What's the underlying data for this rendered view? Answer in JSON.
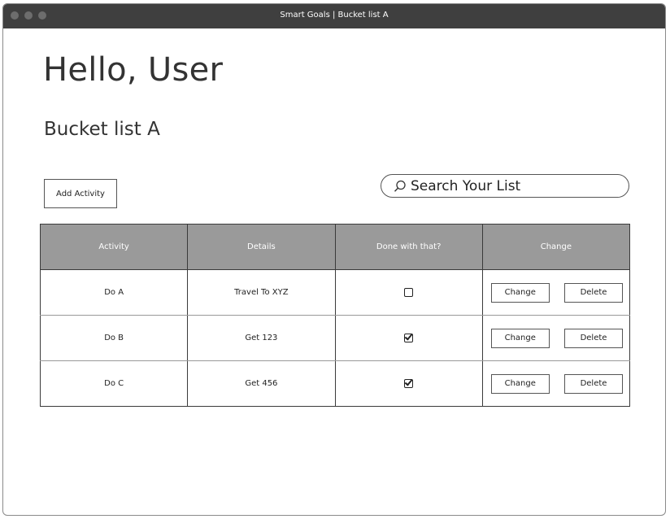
{
  "window": {
    "title": "Smart Goals | Bucket list A"
  },
  "header": {
    "greeting": "Hello, User",
    "list_title": "Bucket list A"
  },
  "toolbar": {
    "add_label": "Add Activity"
  },
  "search": {
    "placeholder": "Search Your List",
    "icon": "search-icon"
  },
  "table": {
    "columns": [
      "Activity",
      "Details",
      "Done with that?",
      "Change"
    ],
    "rows": [
      {
        "activity": "Do A",
        "details": "Travel To XYZ",
        "done": false,
        "change_label": "Change",
        "delete_label": "Delete"
      },
      {
        "activity": "Do B",
        "details": "Get 123",
        "done": true,
        "change_label": "Change",
        "delete_label": "Delete"
      },
      {
        "activity": "Do C",
        "details": "Get 456",
        "done": true,
        "change_label": "Change",
        "delete_label": "Delete"
      }
    ]
  },
  "colors": {
    "titlebar": "#3f3f3f",
    "header_bg": "#9a9a9a",
    "text": "#333333"
  }
}
